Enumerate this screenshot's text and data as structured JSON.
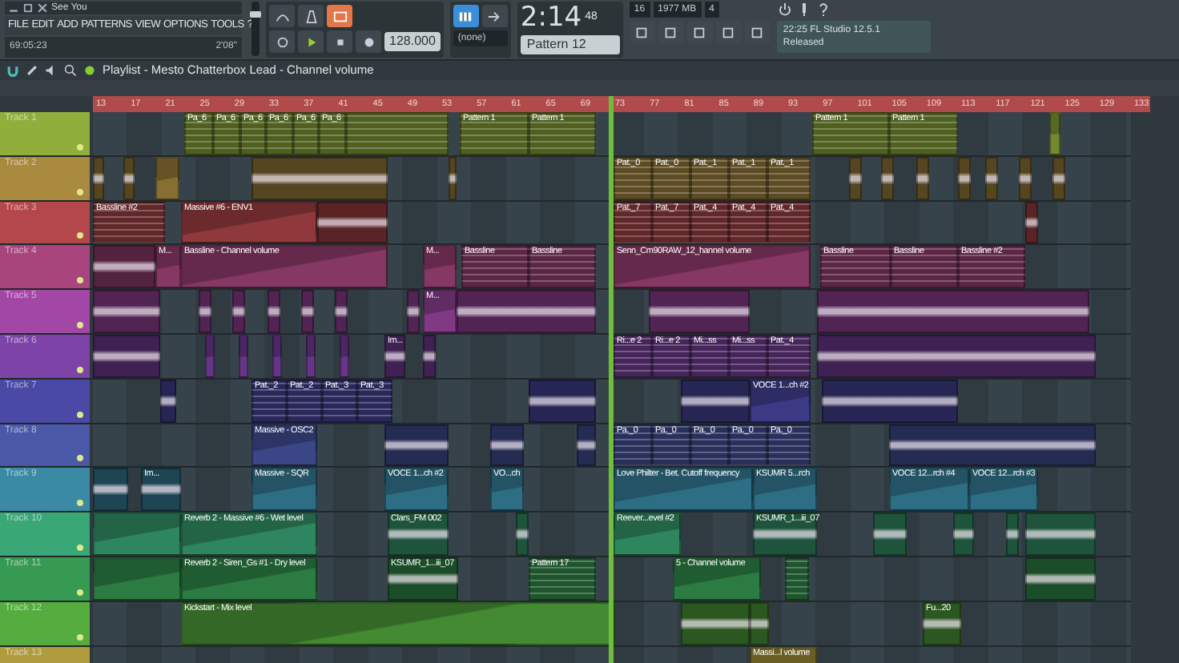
{
  "song_panel": {
    "title": "See You",
    "menu": [
      "FILE",
      "EDIT",
      "ADD",
      "PATTERNS",
      "VIEW",
      "OPTIONS",
      "TOOLS",
      "?"
    ],
    "position": "69:05:23",
    "length": "2'08\""
  },
  "master_volume": {
    "level": 0.8
  },
  "transport": {
    "mode_song": true,
    "tempo": "128.000",
    "time": "2:14",
    "time_small": "48",
    "pattern": "Pattern 12",
    "preset": "(none)"
  },
  "monitor": {
    "cpu": "16",
    "memory": "1977 MB",
    "polyphony": "4"
  },
  "hint": {
    "version": "22:25  FL Studio 12.5.1",
    "status": "Released"
  },
  "playlist": {
    "title": "Playlist - Mesto Chatterbox Lead - Channel volume",
    "ruler": [
      "13",
      "17",
      "21",
      "25",
      "29",
      "33",
      "37",
      "41",
      "45",
      "49",
      "53",
      "57",
      "61",
      "65",
      "69",
      "73",
      "77",
      "81",
      "85",
      "89",
      "93",
      "97",
      "101",
      "105",
      "109",
      "113",
      "117",
      "121",
      "125",
      "129",
      "133"
    ],
    "tracks": [
      {
        "name": "Track 1",
        "color": "#8fae3c",
        "clips": [
          {
            "kind": "pattern",
            "label": "Pa_6"
          },
          {
            "kind": "pattern",
            "label": "Pa_6"
          },
          {
            "kind": "pattern",
            "label": "Pa_6"
          },
          {
            "kind": "pattern",
            "label": "Pa_6"
          },
          {
            "kind": "pattern",
            "label": "Pa_6"
          },
          {
            "kind": "pattern",
            "label": "Pa_6"
          },
          {
            "kind": "pattern"
          },
          {
            "kind": "pattern",
            "label": "Pattern 1"
          },
          {
            "kind": "pattern",
            "label": "Pattern 1"
          },
          {
            "kind": "pattern",
            "label": "Pattern 1"
          },
          {
            "kind": "pattern",
            "label": "Pattern 1"
          },
          {
            "kind": "automation"
          }
        ]
      },
      {
        "name": "Track 2",
        "color": "#a98a3f",
        "clips": [
          {
            "kind": "audio"
          },
          {
            "kind": "audio"
          },
          {
            "kind": "automation"
          },
          {
            "kind": "audio"
          },
          {
            "kind": "audio"
          },
          {
            "kind": "pattern",
            "label": "Pat._0"
          },
          {
            "kind": "pattern",
            "label": "Pat._0"
          },
          {
            "kind": "pattern",
            "label": "Pat._1"
          },
          {
            "kind": "pattern",
            "label": "Pat._1"
          },
          {
            "kind": "pattern",
            "label": "Pat._1"
          },
          {
            "kind": "audio"
          },
          {
            "kind": "audio"
          },
          {
            "kind": "audio"
          },
          {
            "kind": "audio"
          },
          {
            "kind": "audio"
          },
          {
            "kind": "audio"
          },
          {
            "kind": "audio"
          }
        ]
      },
      {
        "name": "Track 3",
        "color": "#b3474b",
        "clips": [
          {
            "kind": "pattern",
            "label": "Bassline #2"
          },
          {
            "kind": "automation",
            "label": "Massive #6 - ENV1"
          },
          {
            "kind": "audio"
          },
          {
            "kind": "pattern",
            "label": "Pat._7"
          },
          {
            "kind": "pattern",
            "label": "Pat._7"
          },
          {
            "kind": "pattern",
            "label": "Pat._4"
          },
          {
            "kind": "pattern",
            "label": "Pat._4"
          },
          {
            "kind": "pattern",
            "label": "Pat._4"
          },
          {
            "kind": "audio"
          }
        ]
      },
      {
        "name": "Track 4",
        "color": "#a8457d",
        "clips": [
          {
            "kind": "audio"
          },
          {
            "kind": "automation",
            "label": "M..."
          },
          {
            "kind": "automation",
            "label": "Bassline - Channel volume"
          },
          {
            "kind": "automation",
            "label": "M..."
          },
          {
            "kind": "pattern",
            "label": "Bassline"
          },
          {
            "kind": "pattern",
            "label": "Bassline"
          },
          {
            "kind": "automation",
            "label": "Senn_Cm90RAW_12_hannel volume"
          },
          {
            "kind": "pattern",
            "label": "Bassline"
          },
          {
            "kind": "pattern",
            "label": "Bassline"
          },
          {
            "kind": "pattern",
            "label": "Bassline #2"
          }
        ]
      },
      {
        "name": "Track 5",
        "color": "#a247a6",
        "clips": [
          {
            "kind": "audio"
          },
          {
            "kind": "audio"
          },
          {
            "kind": "audio"
          },
          {
            "kind": "audio"
          },
          {
            "kind": "audio"
          },
          {
            "kind": "audio"
          },
          {
            "kind": "audio"
          },
          {
            "kind": "automation",
            "label": "M..."
          },
          {
            "kind": "audio"
          },
          {
            "kind": "audio"
          },
          {
            "kind": "audio"
          }
        ]
      },
      {
        "name": "Track 6",
        "color": "#7d43a6",
        "clips": [
          {
            "kind": "audio"
          },
          {
            "kind": "automation"
          },
          {
            "kind": "automation"
          },
          {
            "kind": "automation"
          },
          {
            "kind": "automation"
          },
          {
            "kind": "automation"
          },
          {
            "kind": "audio",
            "label": "Im..."
          },
          {
            "kind": "audio"
          },
          {
            "kind": "pattern",
            "label": "Ri...e 2"
          },
          {
            "kind": "pattern",
            "label": "Ri...e 2"
          },
          {
            "kind": "pattern",
            "label": "Mi...ss"
          },
          {
            "kind": "pattern",
            "label": "Mi...ss"
          },
          {
            "kind": "pattern",
            "label": "Pat._4"
          },
          {
            "kind": "audio"
          }
        ]
      },
      {
        "name": "Track 7",
        "color": "#4b49a6",
        "clips": [
          {
            "kind": "audio"
          },
          {
            "kind": "pattern",
            "label": "Pat._2"
          },
          {
            "kind": "pattern",
            "label": "Pat._2"
          },
          {
            "kind": "pattern",
            "label": "Pat._3"
          },
          {
            "kind": "pattern",
            "label": "Pat._3"
          },
          {
            "kind": "audio"
          },
          {
            "kind": "audio"
          },
          {
            "kind": "automation",
            "label": "VOCE 1...ch #2"
          },
          {
            "kind": "audio"
          }
        ]
      },
      {
        "name": "Track 8",
        "color": "#4a58a8",
        "clips": [
          {
            "kind": "automation",
            "label": "Massive - OSC2"
          },
          {
            "kind": "audio"
          },
          {
            "kind": "audio"
          },
          {
            "kind": "audio"
          },
          {
            "kind": "pattern",
            "label": "Pa._0"
          },
          {
            "kind": "pattern",
            "label": "Pa._0"
          },
          {
            "kind": "pattern",
            "label": "Pa._0"
          },
          {
            "kind": "pattern",
            "label": "Pa._0"
          },
          {
            "kind": "pattern",
            "label": "Pa._0"
          },
          {
            "kind": "audio"
          }
        ]
      },
      {
        "name": "Track 9",
        "color": "#3a8aa6",
        "clips": [
          {
            "kind": "audio"
          },
          {
            "kind": "audio",
            "label": "Im..."
          },
          {
            "kind": "automation",
            "label": "Massive - SQR"
          },
          {
            "kind": "automation",
            "label": "VOCE 1...ch #2"
          },
          {
            "kind": "automation",
            "label": "VO...ch"
          },
          {
            "kind": "automation",
            "label": "Love Philter - Bet. Cutoff frequency"
          },
          {
            "kind": "automation",
            "label": "KSUMR 5...rch"
          },
          {
            "kind": "automation",
            "label": "VOCE 12...rch #4"
          },
          {
            "kind": "automation",
            "label": "VOCE 12...rch #3"
          }
        ]
      },
      {
        "name": "Track 10",
        "color": "#3aa776",
        "clips": [
          {
            "kind": "automation"
          },
          {
            "kind": "automation",
            "label": "Reverb 2 - Massive #6 - Wet level"
          },
          {
            "kind": "audio",
            "label": "Clars_FM 002"
          },
          {
            "kind": "audio"
          },
          {
            "kind": "automation",
            "label": "Reever...evel #2"
          },
          {
            "kind": "audio",
            "label": "KSUMR_1...iii_07"
          },
          {
            "kind": "audio"
          },
          {
            "kind": "audio"
          },
          {
            "kind": "audio"
          },
          {
            "kind": "audio"
          }
        ]
      },
      {
        "name": "Track 11",
        "color": "#369a52",
        "clips": [
          {
            "kind": "automation"
          },
          {
            "kind": "automation",
            "label": "Reverb 2 - Siren_Gs #1 - Dry level"
          },
          {
            "kind": "audio",
            "label": "KSUMR_1...iii_07"
          },
          {
            "kind": "pattern",
            "label": "Pattern 17"
          },
          {
            "kind": "automation",
            "label": "5 - Channel volume"
          },
          {
            "kind": "pattern"
          },
          {
            "kind": "audio"
          }
        ]
      },
      {
        "name": "Track 12",
        "color": "#55ad40",
        "clips": [
          {
            "kind": "automation",
            "label": "Kickstart - Mix level"
          },
          {
            "kind": "audio"
          },
          {
            "kind": "audio"
          },
          {
            "kind": "audio",
            "label": "Fu...20"
          }
        ]
      },
      {
        "name": "Track 13",
        "color": "#b09c3e",
        "clips": [
          {
            "kind": "automation",
            "label": "Massi...l volume"
          }
        ]
      }
    ]
  }
}
